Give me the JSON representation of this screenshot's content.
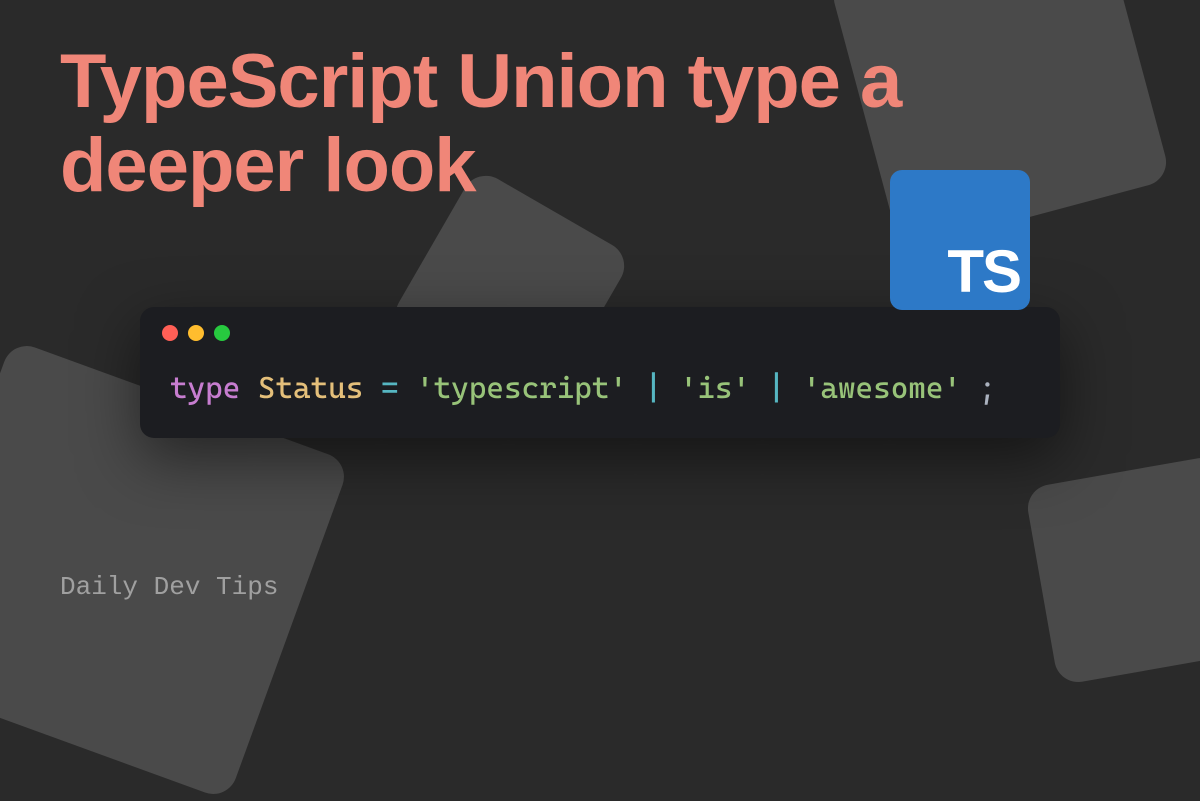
{
  "title": "TypeScript Union type a deeper look",
  "logo": {
    "text": "TS"
  },
  "code": {
    "keyword": "type",
    "typename": "Status",
    "eq": "=",
    "strings": [
      "'typescript'",
      "'is'",
      "'awesome'"
    ],
    "pipe": "|",
    "semi": ";"
  },
  "footer": "Daily Dev Tips",
  "colors": {
    "background": "#2a2a2a",
    "title": "#f08678",
    "logo_bg": "#2d79c7",
    "code_bg": "#1c1d21"
  }
}
